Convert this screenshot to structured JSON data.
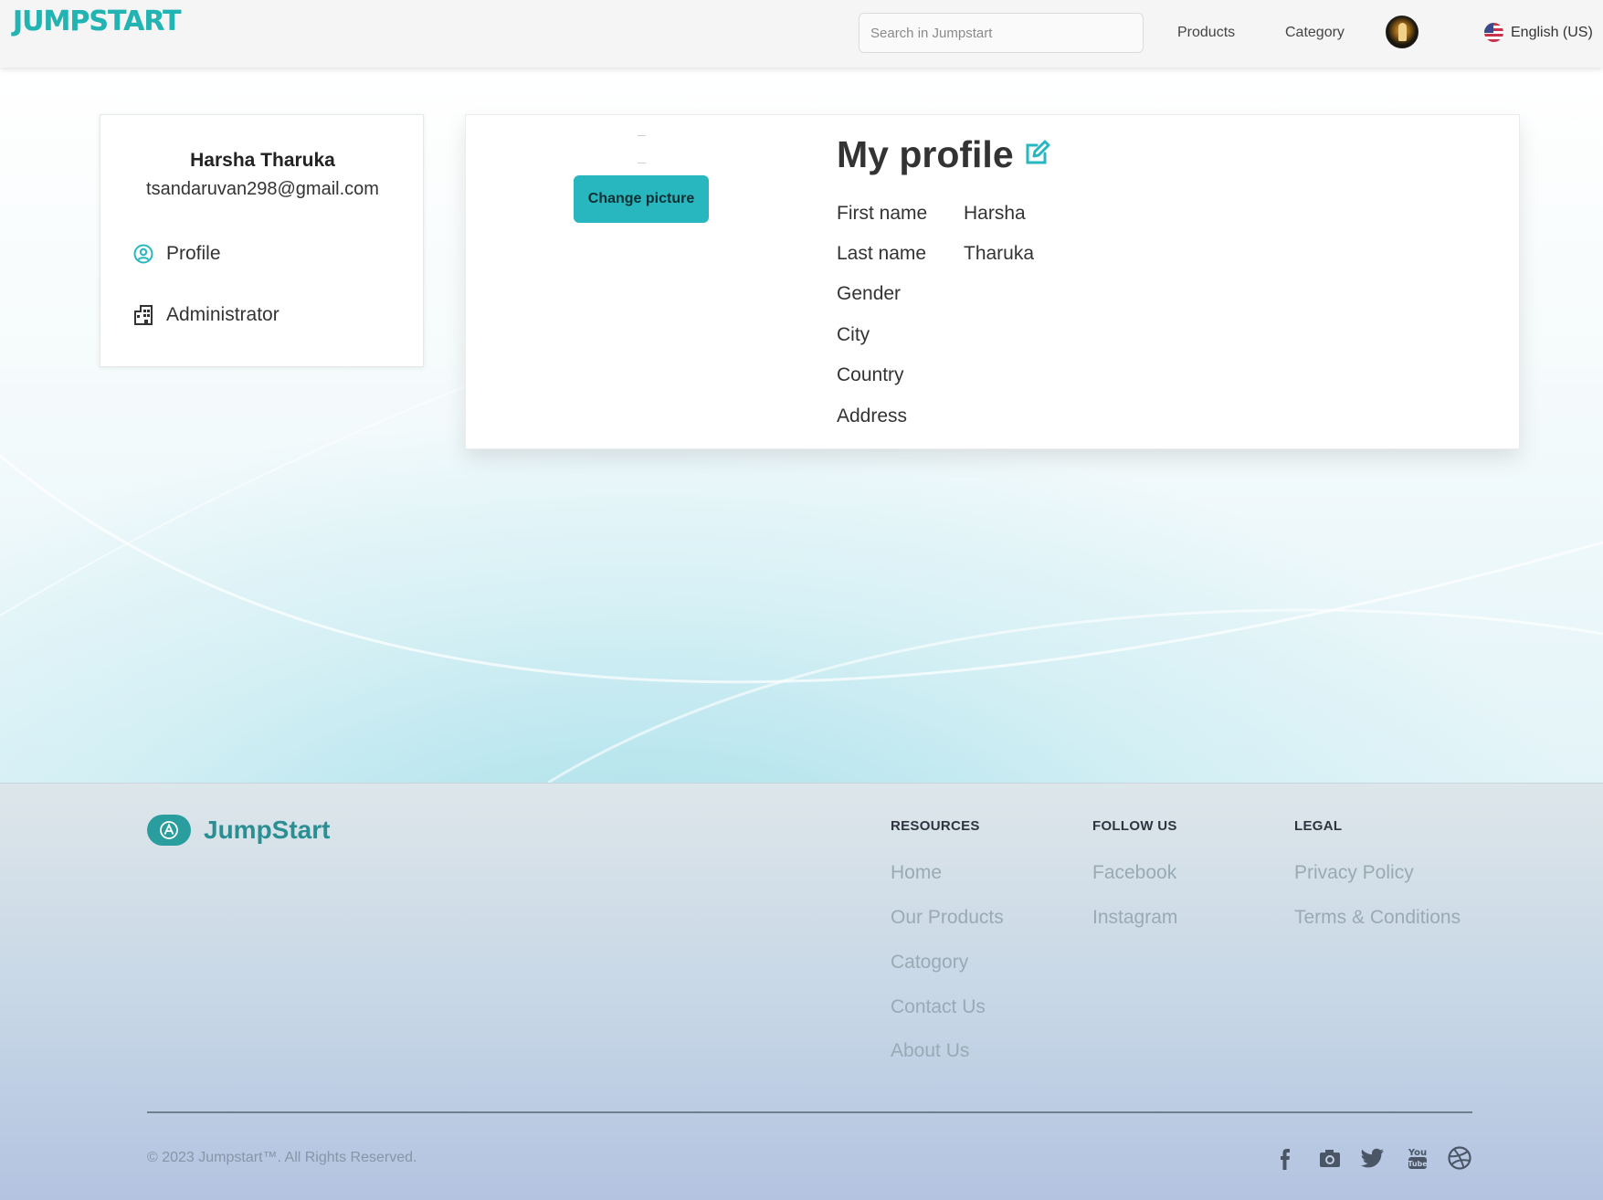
{
  "header": {
    "logo": "JUMPSTART",
    "search_placeholder": "Search in Jumpstart",
    "nav": [
      "Products",
      "Category"
    ],
    "language": "English (US)"
  },
  "sidebar": {
    "name": "Harsha Tharuka",
    "email": "tsandaruvan298@gmail.com",
    "items": [
      {
        "label": "Profile",
        "icon": "user-circle-icon"
      },
      {
        "label": "Administrator",
        "icon": "building-icon"
      }
    ]
  },
  "profile": {
    "title": "My profile",
    "change_picture": "Change picture",
    "fields": [
      {
        "label": "First name",
        "value": "Harsha"
      },
      {
        "label": "Last name",
        "value": "Tharuka"
      },
      {
        "label": "Gender",
        "value": ""
      },
      {
        "label": "City",
        "value": ""
      },
      {
        "label": "Country",
        "value": ""
      },
      {
        "label": "Address",
        "value": ""
      }
    ]
  },
  "footer": {
    "brand": "JumpStart",
    "columns": [
      {
        "heading": "RESOURCES",
        "links": [
          "Home",
          "Our Products",
          "Catogory",
          "Contact Us",
          "About Us"
        ]
      },
      {
        "heading": "FOLLOW US",
        "links": [
          "Facebook",
          "Instagram"
        ]
      },
      {
        "heading": "LEGAL",
        "links": [
          "Privacy Policy",
          "Terms & Conditions"
        ]
      }
    ],
    "copyright": "© 2023 Jumpstart™. All Rights Reserved.",
    "social_icons": [
      "facebook-icon",
      "camera-icon",
      "twitter-icon",
      "youtube-icon",
      "dribbble-icon"
    ]
  },
  "colors": {
    "accent": "#28b7bf",
    "footer_brand": "#2a9d9f"
  }
}
